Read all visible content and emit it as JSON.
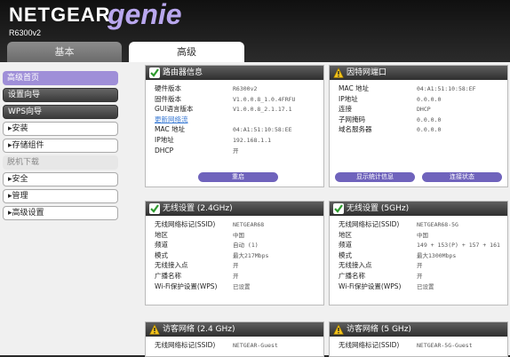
{
  "header": {
    "brand": "NETGEAR",
    "genie": "genie",
    "model": "R6300v2"
  },
  "tabs": {
    "basic": "基本",
    "advanced": "高级"
  },
  "sidebar": {
    "items": [
      {
        "label": "高级首页",
        "style": "selected"
      },
      {
        "label": "设置向导",
        "style": "dark"
      },
      {
        "label": "WPS向导",
        "style": "dark"
      },
      {
        "label": "▸安装",
        "style": "white"
      },
      {
        "label": "▸存储组件",
        "style": "white"
      },
      {
        "label": "脱机下载",
        "style": "disabled"
      },
      {
        "label": "▸安全",
        "style": "white"
      },
      {
        "label": "▸管理",
        "style": "white"
      },
      {
        "label": "▸高级设置",
        "style": "white"
      }
    ]
  },
  "router_info": {
    "title": "路由器信息",
    "status_icon": "check-icon",
    "rows": [
      {
        "k": "硬件版本",
        "v": "R6300v2"
      },
      {
        "k": "固件版本",
        "v": "V1.0.0.8_1.0.4FRFU"
      },
      {
        "k": "GUI语言版本",
        "v": "V1.0.0.8_2.1.17.1"
      },
      {
        "k": "",
        "v": ""
      },
      {
        "k": "MAC 地址",
        "v": "04:A1:51:10:58:EE"
      },
      {
        "k": "IP地址",
        "v": "192.168.1.1"
      },
      {
        "k": "DHCP",
        "v": "开"
      }
    ],
    "link": "更新网络流",
    "button": "重启"
  },
  "internet_port": {
    "title": "因特网端口",
    "status_icon": "warning-icon",
    "rows": [
      {
        "k": "MAC 地址",
        "v": "04:A1:51:10:58:EF"
      },
      {
        "k": "IP地址",
        "v": "0.0.0.0"
      },
      {
        "k": "连接",
        "v": "DHCP"
      },
      {
        "k": "子网掩码",
        "v": "0.0.0.0"
      },
      {
        "k": "域名服务器",
        "v": "0.0.0.0"
      }
    ],
    "buttons": [
      "显示统计信息",
      "连接状态"
    ]
  },
  "wifi24": {
    "title": "无线设置 (2.4GHz)",
    "status_icon": "check-icon",
    "rows": [
      {
        "k": "无线网络标记(SSID)",
        "v": "NETGEAR68"
      },
      {
        "k": "地区",
        "v": "中国"
      },
      {
        "k": "频道",
        "v": "自动 (1)"
      },
      {
        "k": "模式",
        "v": "最大217Mbps"
      },
      {
        "k": "无线接入点",
        "v": "开"
      },
      {
        "k": "广播名称",
        "v": "开"
      },
      {
        "k": "Wi-Fi保护设置(WPS)",
        "v": "已设置"
      }
    ]
  },
  "wifi5": {
    "title": "无线设置 (5GHz)",
    "status_icon": "check-icon",
    "rows": [
      {
        "k": "无线网络标记(SSID)",
        "v": "NETGEAR68-5G"
      },
      {
        "k": "地区",
        "v": "中国"
      },
      {
        "k": "频道",
        "v": "149 + 153(P) + 157 + 161"
      },
      {
        "k": "模式",
        "v": "最大1300Mbps"
      },
      {
        "k": "无线接入点",
        "v": "开"
      },
      {
        "k": "广播名称",
        "v": "开"
      },
      {
        "k": "Wi-Fi保护设置(WPS)",
        "v": "已设置"
      }
    ]
  },
  "guest24": {
    "title": "访客网络 (2.4 GHz)",
    "status_icon": "warning-icon",
    "rows": [
      {
        "k": "无线网络标记(SSID)",
        "v": "NETGEAR-Guest"
      }
    ]
  },
  "guest5": {
    "title": "访客网络 (5 GHz)",
    "status_icon": "warning-icon",
    "rows": [
      {
        "k": "无线网络标记(SSID)",
        "v": "NETGEAR-5G-Guest"
      }
    ]
  }
}
